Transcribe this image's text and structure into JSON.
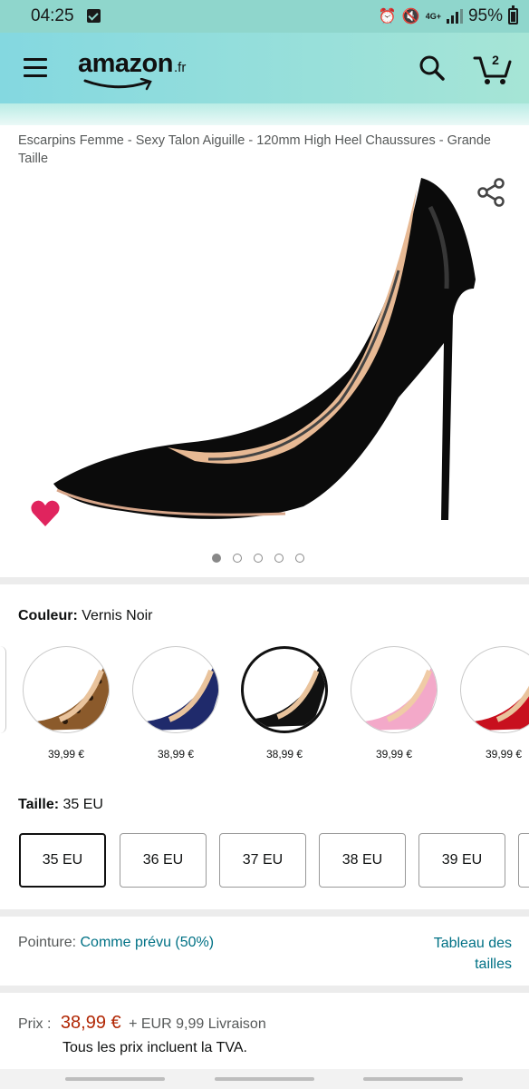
{
  "status_bar": {
    "time": "04:25",
    "network": "4G+",
    "battery": "95%"
  },
  "header": {
    "logo": "amazon",
    "logo_tld": ".fr",
    "cart_count": "2"
  },
  "product": {
    "title": "Escarpins Femme - Sexy Talon Aiguille - 120mm High Heel Chaussures - Grande Taille",
    "image_count": 5,
    "active_image": 0
  },
  "color": {
    "label": "Couleur:",
    "value": "Vernis Noir",
    "swatches": [
      {
        "price": "39,99 €",
        "name": "leopard",
        "color": "#8b5a2b"
      },
      {
        "price": "38,99 €",
        "name": "navy",
        "color": "#1f2a6b"
      },
      {
        "price": "38,99 €",
        "name": "black",
        "color": "#111111"
      },
      {
        "price": "39,99 €",
        "name": "pink",
        "color": "#f3a9c9"
      },
      {
        "price": "39,99 €",
        "name": "red",
        "color": "#c8101e"
      }
    ]
  },
  "size": {
    "label": "Taille:",
    "value": "35 EU",
    "options": [
      "35 EU",
      "36 EU",
      "37 EU",
      "38 EU",
      "39 EU"
    ]
  },
  "fit": {
    "label": "Pointure:",
    "value": "Comme prévu (50%)",
    "size_chart": "Tableau des tailles"
  },
  "pricing": {
    "label": "Prix :",
    "price": "38,99 €",
    "shipping": "+ EUR 9,99 Livraison",
    "tax_note": "Tous les prix incluent la TVA."
  }
}
